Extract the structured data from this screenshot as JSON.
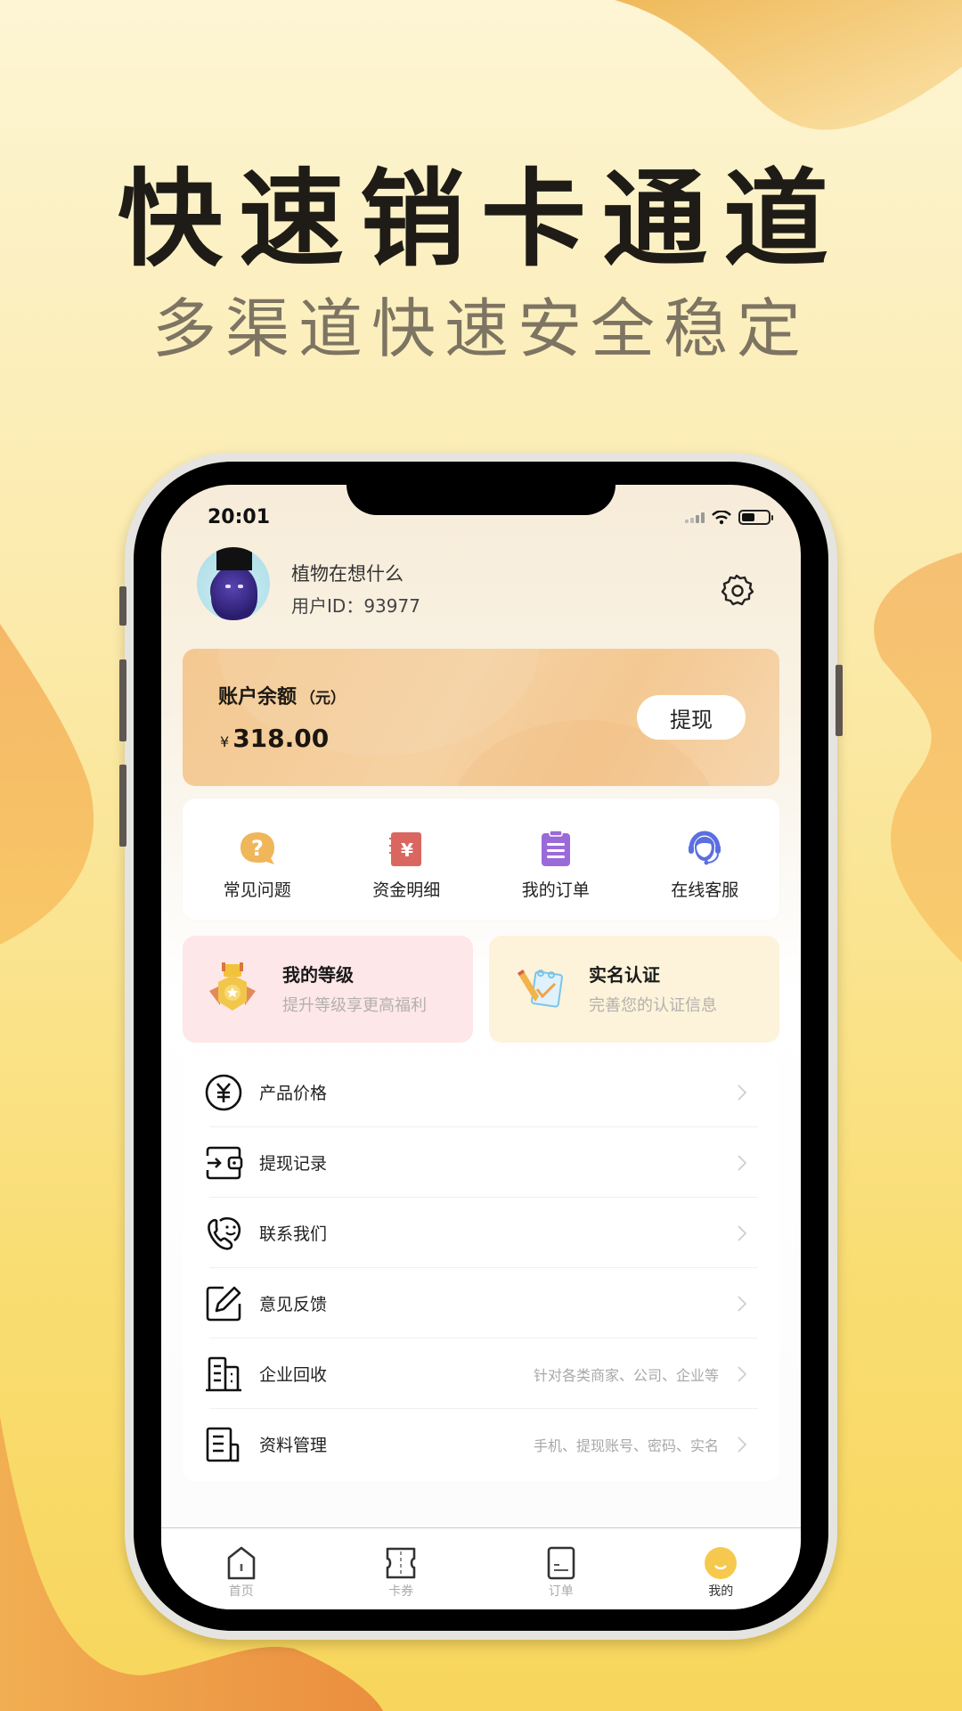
{
  "promo": {
    "headline": "快速销卡通道",
    "subline": "多渠道快速安全稳定"
  },
  "status_bar": {
    "time": "20:01"
  },
  "profile": {
    "username": "植物在想什么",
    "user_id_label": "用户ID：",
    "user_id": "93977"
  },
  "balance": {
    "label": "账户余额",
    "unit": "（元）",
    "currency_symbol": "¥",
    "amount": "318.00",
    "withdraw_label": "提现"
  },
  "quick_actions": [
    {
      "label": "常见问题",
      "icon": "question-bubble-icon",
      "color": "#f0b65a"
    },
    {
      "label": "资金明细",
      "icon": "ledger-yuan-icon",
      "color": "#d9675f"
    },
    {
      "label": "我的订单",
      "icon": "clipboard-list-icon",
      "color": "#9b6ad9"
    },
    {
      "label": "在线客服",
      "icon": "headset-agent-icon",
      "color": "#5b6fe0"
    }
  ],
  "promo_cards": [
    {
      "title": "我的等级",
      "subtitle": "提升等级享更高福利",
      "icon": "medal-icon"
    },
    {
      "title": "实名认证",
      "subtitle": "完善您的认证信息",
      "icon": "pencil-calendar-icon"
    }
  ],
  "menu": [
    {
      "label": "产品价格",
      "hint": "",
      "icon": "yuan-circle-icon"
    },
    {
      "label": "提现记录",
      "hint": "",
      "icon": "wallet-in-icon"
    },
    {
      "label": "联系我们",
      "hint": "",
      "icon": "phone-smile-icon"
    },
    {
      "label": "意见反馈",
      "hint": "",
      "icon": "edit-square-icon"
    },
    {
      "label": "企业回收",
      "hint": "针对各类商家、公司、企业等",
      "icon": "building-icon"
    },
    {
      "label": "资料管理",
      "hint": "手机、提现账号、密码、实名",
      "icon": "document-icon"
    }
  ],
  "tabs": [
    {
      "label": "首页",
      "icon": "home-icon",
      "active": false
    },
    {
      "label": "卡券",
      "icon": "ticket-icon",
      "active": false
    },
    {
      "label": "订单",
      "icon": "order-icon",
      "active": false
    },
    {
      "label": "我的",
      "icon": "profile-smile-icon",
      "active": true
    }
  ],
  "colors": {
    "accent": "#f6c94e",
    "balance_card": "#f4c891"
  }
}
